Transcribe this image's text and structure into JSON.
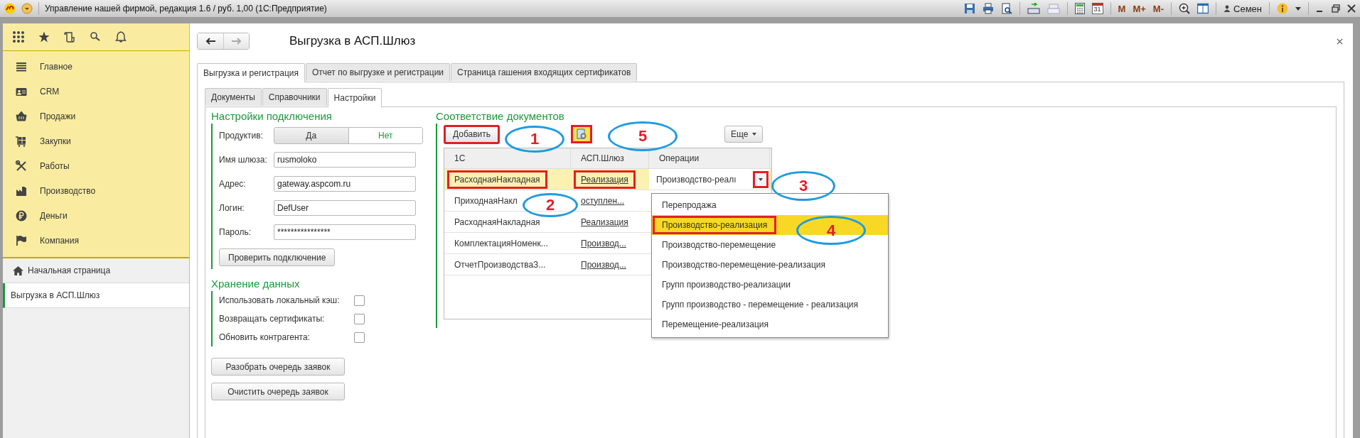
{
  "window": {
    "title": "Управление нашей фирмой, редакция 1.6 / руб. 1,00  (1С:Предприятие)"
  },
  "toolbar": {
    "calendar_day": "31",
    "memory_buttons": [
      "M",
      "M+",
      "M-"
    ],
    "user": "Семен"
  },
  "sidebar": {
    "items": [
      {
        "label": "Главное"
      },
      {
        "label": "CRM"
      },
      {
        "label": "Продажи"
      },
      {
        "label": "Закупки"
      },
      {
        "label": "Работы"
      },
      {
        "label": "Производство"
      },
      {
        "label": "Деньги"
      },
      {
        "label": "Компания"
      }
    ],
    "open_windows": [
      {
        "label": "Начальная страница",
        "kind": "home",
        "selected": false
      },
      {
        "label": "Выгрузка в АСП.Шлюз",
        "kind": "form",
        "selected": true
      }
    ]
  },
  "form": {
    "title": "Выгрузка в АСП.Шлюз",
    "tabs": [
      {
        "label": "Выгрузка и регистрация",
        "selected": true
      },
      {
        "label": "Отчет по выгрузке и регистрации",
        "selected": false
      },
      {
        "label": "Страница гашения входящих сертификатов",
        "selected": false
      }
    ],
    "subtabs": [
      {
        "label": "Документы",
        "selected": false
      },
      {
        "label": "Справочники",
        "selected": false
      },
      {
        "label": "Настройки",
        "selected": true
      }
    ],
    "connection": {
      "heading": "Настройки подключения",
      "productive": {
        "label": "Продуктив:",
        "options": [
          {
            "label": "Да",
            "selected": true
          },
          {
            "label": "Нет",
            "selected": false
          }
        ]
      },
      "fields": [
        {
          "label": "Имя шлюза:",
          "value": "rusmoloko"
        },
        {
          "label": "Адрес:",
          "value": "gateway.aspcom.ru"
        },
        {
          "label": "Логин:",
          "value": "DefUser"
        },
        {
          "label": "Пароль:",
          "value": "****************"
        }
      ],
      "check_button": "Проверить подключение"
    },
    "storage": {
      "heading": "Хранение данных",
      "options": [
        {
          "label": "Использовать локальный кэш:",
          "checked": false
        },
        {
          "label": "Возвращать сертификаты:",
          "checked": false
        },
        {
          "label": "Обновить контрагента:",
          "checked": false
        }
      ]
    },
    "buttons": [
      "Разобрать очередь заявок",
      "Очистить очередь заявок"
    ],
    "mapping": {
      "heading": "Соответствие документов",
      "add_button": {
        "label": "Добавить",
        "highlighted": true
      },
      "settings_button": {
        "highlighted": true
      },
      "more_button": "Еще",
      "columns": [
        "1С",
        "АСП.Шлюз",
        "Операции"
      ],
      "rows": [
        {
          "selected": true,
          "cells": [
            {
              "kind": "text",
              "text": "РасходнаяНакладная",
              "highlighted": true
            },
            {
              "kind": "link",
              "text": "Реализация",
              "highlighted": true
            },
            {
              "kind": "edit",
              "text": "Производство-реалı",
              "highlighted": true
            }
          ]
        },
        {
          "selected": false,
          "cells": [
            {
              "kind": "text",
              "text": "ПриходнаяНакл",
              "highlighted": false
            },
            {
              "kind": "link",
              "text": "оступлен...",
              "highlighted": false
            }
          ]
        },
        {
          "selected": false,
          "cells": [
            {
              "kind": "text",
              "text": "РасходнаяНакладная",
              "highlighted": false
            },
            {
              "kind": "link",
              "text": "Реализация",
              "highlighted": false
            }
          ]
        },
        {
          "selected": false,
          "cells": [
            {
              "kind": "text",
              "text": "КомплектацияНоменк...",
              "highlighted": false
            },
            {
              "kind": "link",
              "text": "Производ...",
              "highlighted": false
            }
          ]
        },
        {
          "selected": false,
          "cells": [
            {
              "kind": "text",
              "text": "ОтчетПроизводстваЗ...",
              "highlighted": false
            },
            {
              "kind": "link",
              "text": "Производ...",
              "highlighted": false
            }
          ]
        }
      ],
      "dropdown": [
        {
          "label": "Перепродажа",
          "selected": false,
          "highlighted": false
        },
        {
          "label": "Производство-реализация",
          "selected": true,
          "highlighted": true
        },
        {
          "label": "Производство-перемещение",
          "selected": false,
          "highlighted": false
        },
        {
          "label": "Производство-перемещение-реализация",
          "selected": false,
          "highlighted": false
        },
        {
          "label": "Групп производство-реализации",
          "selected": false,
          "highlighted": false
        },
        {
          "label": "Групп производство - перемещение - реализация",
          "selected": false,
          "highlighted": false
        },
        {
          "label": "Перемещение-реализация",
          "selected": false,
          "highlighted": false
        }
      ]
    }
  },
  "annotations": [
    {
      "label": "1"
    },
    {
      "label": "2"
    },
    {
      "label": "3"
    },
    {
      "label": "4"
    },
    {
      "label": "5"
    }
  ]
}
